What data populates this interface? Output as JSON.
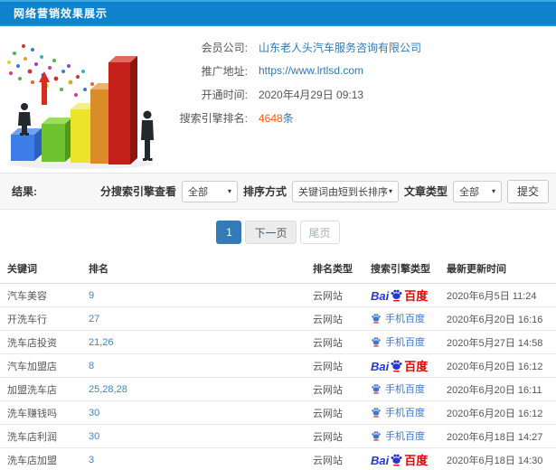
{
  "header": {
    "title": "网络营销效果展示"
  },
  "info": {
    "company_label": "会员公司:",
    "company_value": "山东老人头汽车服务咨询有限公司",
    "url_label": "推广地址:",
    "url_value": "https://www.lrtlsd.com",
    "opened_label": "开通时间:",
    "opened_value": "2020年4月29日 09:13",
    "rank_count_label": "搜索引擎排名:",
    "rank_count_value": "4648",
    "rank_count_unit": "条"
  },
  "filters": {
    "section_label": "结果:",
    "engine_label": "分搜索引擎查看",
    "engine_value": "全部",
    "sort_label": "排序方式",
    "sort_value": "关键词由短到长排序",
    "article_label": "文章类型",
    "article_value": "全部",
    "submit_label": "提交",
    "chevron": "▾"
  },
  "pagination": {
    "current": "1",
    "next_label": "下一页",
    "last_label": "尾页"
  },
  "logos": {
    "baidu_prefix": "Bai",
    "baidu_suffix": "百度",
    "mobile_baidu_label": "手机百度"
  },
  "table": {
    "headers": [
      "关键词",
      "排名",
      "排名类型",
      "搜索引擎类型",
      "最新更新时间"
    ],
    "rows": [
      {
        "keyword": "汽车美容",
        "rank": "9",
        "rank_type": "云网站",
        "engine": "baidu",
        "updated": "2020年6月5日 11:24"
      },
      {
        "keyword": "开洗车行",
        "rank": "27",
        "rank_type": "云网站",
        "engine": "mobile",
        "updated": "2020年6月20日 16:16"
      },
      {
        "keyword": "洗车店投资",
        "rank": "21,26",
        "rank_type": "云网站",
        "engine": "mobile",
        "updated": "2020年5月27日 14:58"
      },
      {
        "keyword": "汽车加盟店",
        "rank": "8",
        "rank_type": "云网站",
        "engine": "baidu",
        "updated": "2020年6月20日 16:12"
      },
      {
        "keyword": "加盟洗车店",
        "rank": "25,28,28",
        "rank_type": "云网站",
        "engine": "mobile",
        "updated": "2020年6月20日 16:11"
      },
      {
        "keyword": "洗车赚钱吗",
        "rank": "30",
        "rank_type": "云网站",
        "engine": "mobile",
        "updated": "2020年6月20日 16:12"
      },
      {
        "keyword": "洗车店利润",
        "rank": "30",
        "rank_type": "云网站",
        "engine": "mobile",
        "updated": "2020年6月18日 14:27"
      },
      {
        "keyword": "洗车店加盟",
        "rank": "3",
        "rank_type": "云网站",
        "engine": "baidu",
        "updated": "2020年6月18日 14:30"
      }
    ]
  },
  "colors": {
    "header_bg": "#0e82cd",
    "link_blue": "#2e79b8",
    "highlight_orange": "#ff5a00",
    "active_page_blue": "#337ab7",
    "baidu_blue": "#2534dd",
    "baidu_red": "#e10601",
    "mobile_badge_blue": "#3f76c8"
  }
}
